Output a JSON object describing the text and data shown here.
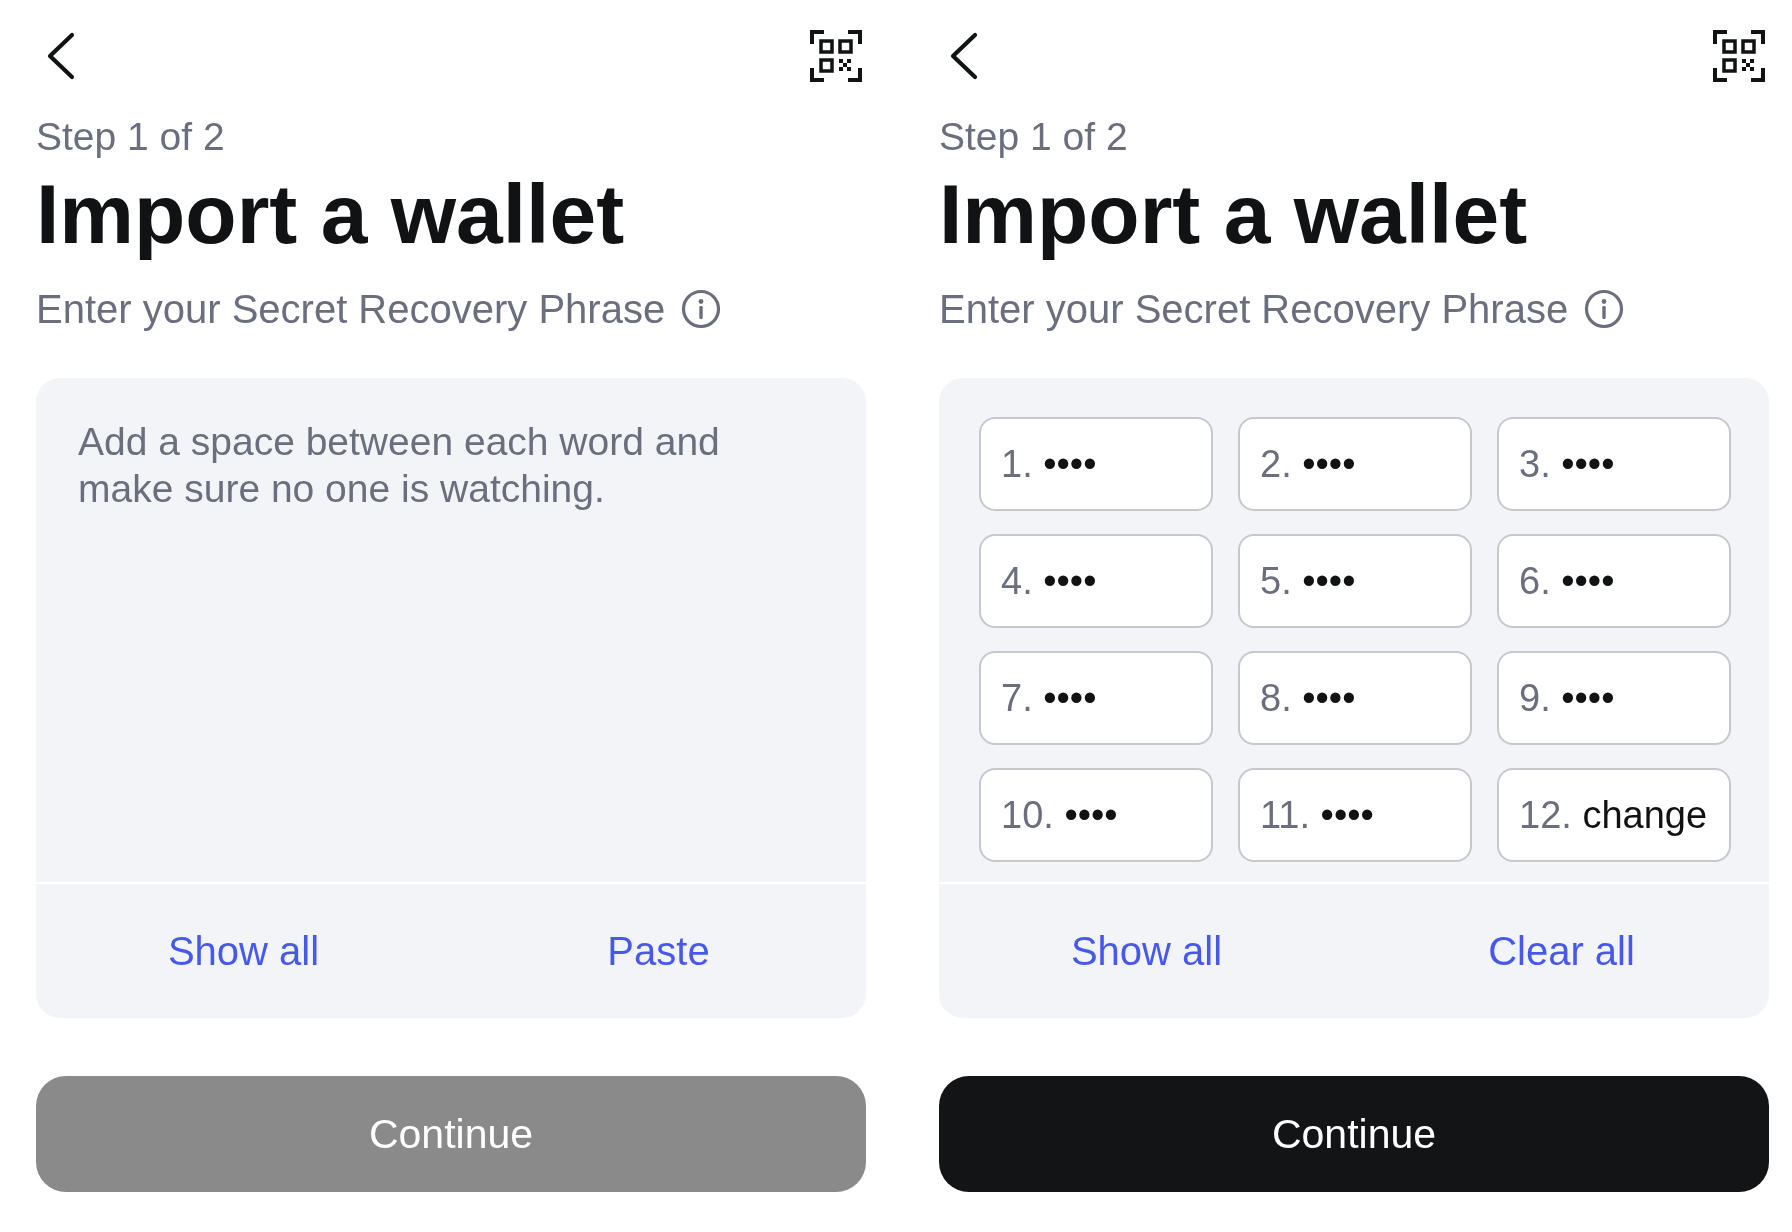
{
  "screens": [
    {
      "step": "Step 1 of 2",
      "title": "Import a wallet",
      "subtitle": "Enter your Secret Recovery Phrase",
      "phrase_input": {
        "kind": "text",
        "placeholder": "Add a space between each word and make sure no one is watching."
      },
      "actions": [
        "Show all",
        "Paste"
      ],
      "continue_button": {
        "label": "Continue",
        "disabled": true
      }
    },
    {
      "step": "Step 1 of 2",
      "title": "Import a wallet",
      "subtitle": "Enter your Secret Recovery Phrase",
      "phrase_input": {
        "kind": "words",
        "words": [
          {
            "number": "1.",
            "value": "••••"
          },
          {
            "number": "2.",
            "value": "••••"
          },
          {
            "number": "3.",
            "value": "••••"
          },
          {
            "number": "4.",
            "value": "••••"
          },
          {
            "number": "5.",
            "value": "••••"
          },
          {
            "number": "6.",
            "value": "••••"
          },
          {
            "number": "7.",
            "value": "••••"
          },
          {
            "number": "8.",
            "value": "••••"
          },
          {
            "number": "9.",
            "value": "••••"
          },
          {
            "number": "10.",
            "value": "••••"
          },
          {
            "number": "11.",
            "value": "••••"
          },
          {
            "number": "12.",
            "value": "change"
          }
        ]
      },
      "actions": [
        "Show all",
        "Clear all"
      ],
      "continue_button": {
        "label": "Continue",
        "disabled": false
      }
    }
  ]
}
